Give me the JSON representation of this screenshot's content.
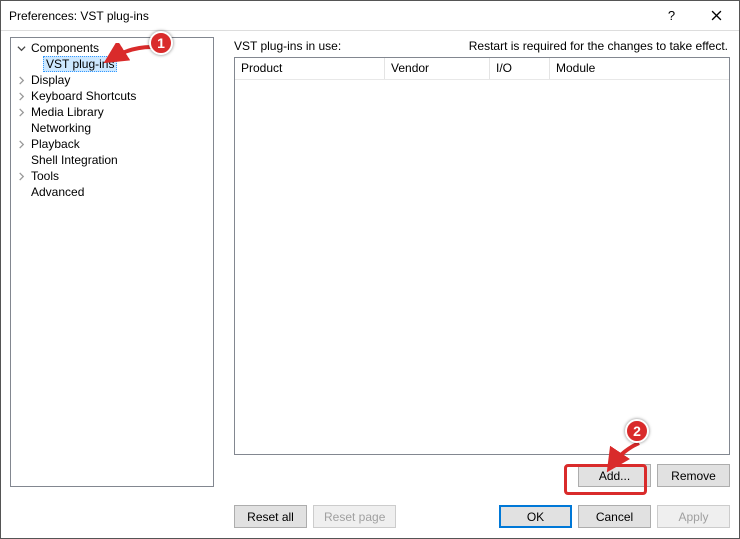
{
  "window": {
    "title": "Preferences: VST plug-ins"
  },
  "tree": {
    "components": "Components",
    "vst": "VST plug-ins",
    "display": "Display",
    "keyboard": "Keyboard Shortcuts",
    "media": "Media Library",
    "networking": "Networking",
    "playback": "Playback",
    "shell": "Shell Integration",
    "tools": "Tools",
    "advanced": "Advanced"
  },
  "panel": {
    "caption": "VST plug-ins in use:",
    "restart": "Restart is required for the changes to take effect.",
    "cols": {
      "product": "Product",
      "vendor": "Vendor",
      "io": "I/O",
      "module": "Module"
    },
    "add": "Add...",
    "remove": "Remove"
  },
  "buttons": {
    "reset_all": "Reset all",
    "reset_page": "Reset page",
    "ok": "OK",
    "cancel": "Cancel",
    "apply": "Apply"
  },
  "markers": {
    "one": "1",
    "two": "2"
  }
}
